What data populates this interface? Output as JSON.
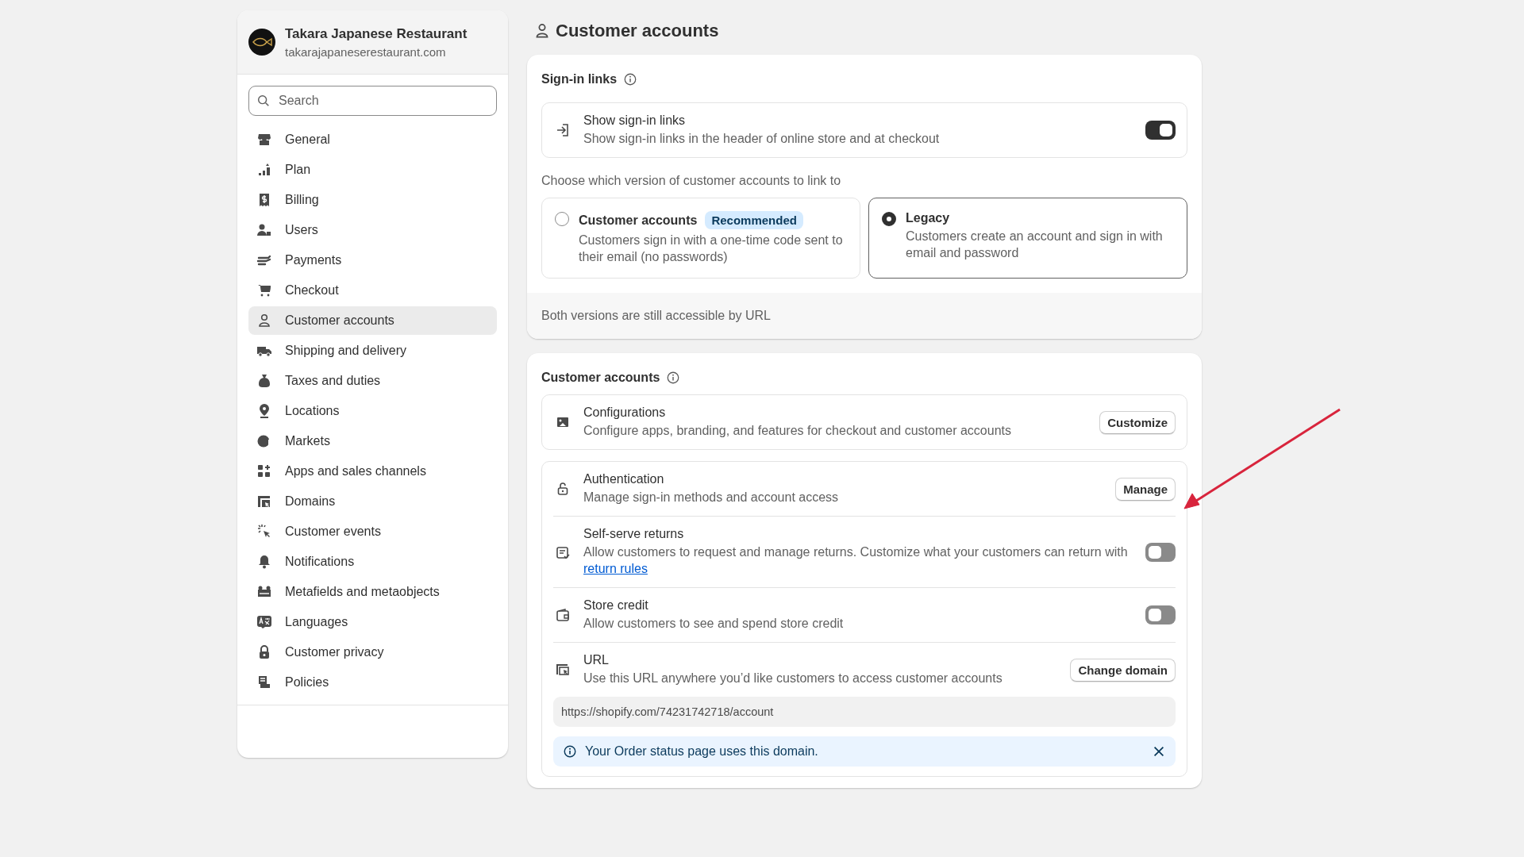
{
  "store": {
    "name": "Takara Japanese Restaurant",
    "domain": "takarajapaneserestaurant.com"
  },
  "search": {
    "placeholder": "Search"
  },
  "nav": [
    {
      "label": "General",
      "selected": false
    },
    {
      "label": "Plan",
      "selected": false
    },
    {
      "label": "Billing",
      "selected": false
    },
    {
      "label": "Users",
      "selected": false
    },
    {
      "label": "Payments",
      "selected": false
    },
    {
      "label": "Checkout",
      "selected": false
    },
    {
      "label": "Customer accounts",
      "selected": true
    },
    {
      "label": "Shipping and delivery",
      "selected": false
    },
    {
      "label": "Taxes and duties",
      "selected": false
    },
    {
      "label": "Locations",
      "selected": false
    },
    {
      "label": "Markets",
      "selected": false
    },
    {
      "label": "Apps and sales channels",
      "selected": false
    },
    {
      "label": "Domains",
      "selected": false
    },
    {
      "label": "Customer events",
      "selected": false
    },
    {
      "label": "Notifications",
      "selected": false
    },
    {
      "label": "Metafields and metaobjects",
      "selected": false
    },
    {
      "label": "Languages",
      "selected": false
    },
    {
      "label": "Customer privacy",
      "selected": false
    },
    {
      "label": "Policies",
      "selected": false
    }
  ],
  "page_title": "Customer accounts",
  "sign_in_links": {
    "heading": "Sign-in links",
    "toggle_row": {
      "title": "Show sign-in links",
      "description": "Show sign-in links in the header of online store and at checkout",
      "on": true
    },
    "prompt": "Choose which version of customer accounts to link to",
    "options": [
      {
        "title": "Customer accounts",
        "badge": "Recommended",
        "description": "Customers sign in with a one-time code sent to their email (no passwords)",
        "selected": false
      },
      {
        "title": "Legacy",
        "description": "Customers create an account and sign in with email and password",
        "selected": true
      }
    ],
    "footer": "Both versions are still accessible by URL"
  },
  "customer_accounts": {
    "heading": "Customer accounts",
    "groups": [
      [
        {
          "kind": "button",
          "title": "Configurations",
          "description": "Configure apps, branding, and features for checkout and customer accounts",
          "button": "Customize"
        }
      ],
      [
        {
          "kind": "button",
          "title": "Authentication",
          "description": "Manage sign-in methods and account access",
          "button": "Manage"
        },
        {
          "kind": "toggle",
          "title": "Self-serve returns",
          "description": "Allow customers to request and manage returns. Customize what your customers can return with",
          "link": "return rules",
          "on": false
        },
        {
          "kind": "toggle",
          "title": "Store credit",
          "description": "Allow customers to see and spend store credit",
          "on": false
        },
        {
          "kind": "url",
          "title": "URL",
          "description": "Use this URL anywhere you’d like customers to access customer accounts",
          "button": "Change domain",
          "url": "https://shopify.com/74231742718/account",
          "notice": "Your Order status page uses this domain."
        }
      ]
    ]
  }
}
